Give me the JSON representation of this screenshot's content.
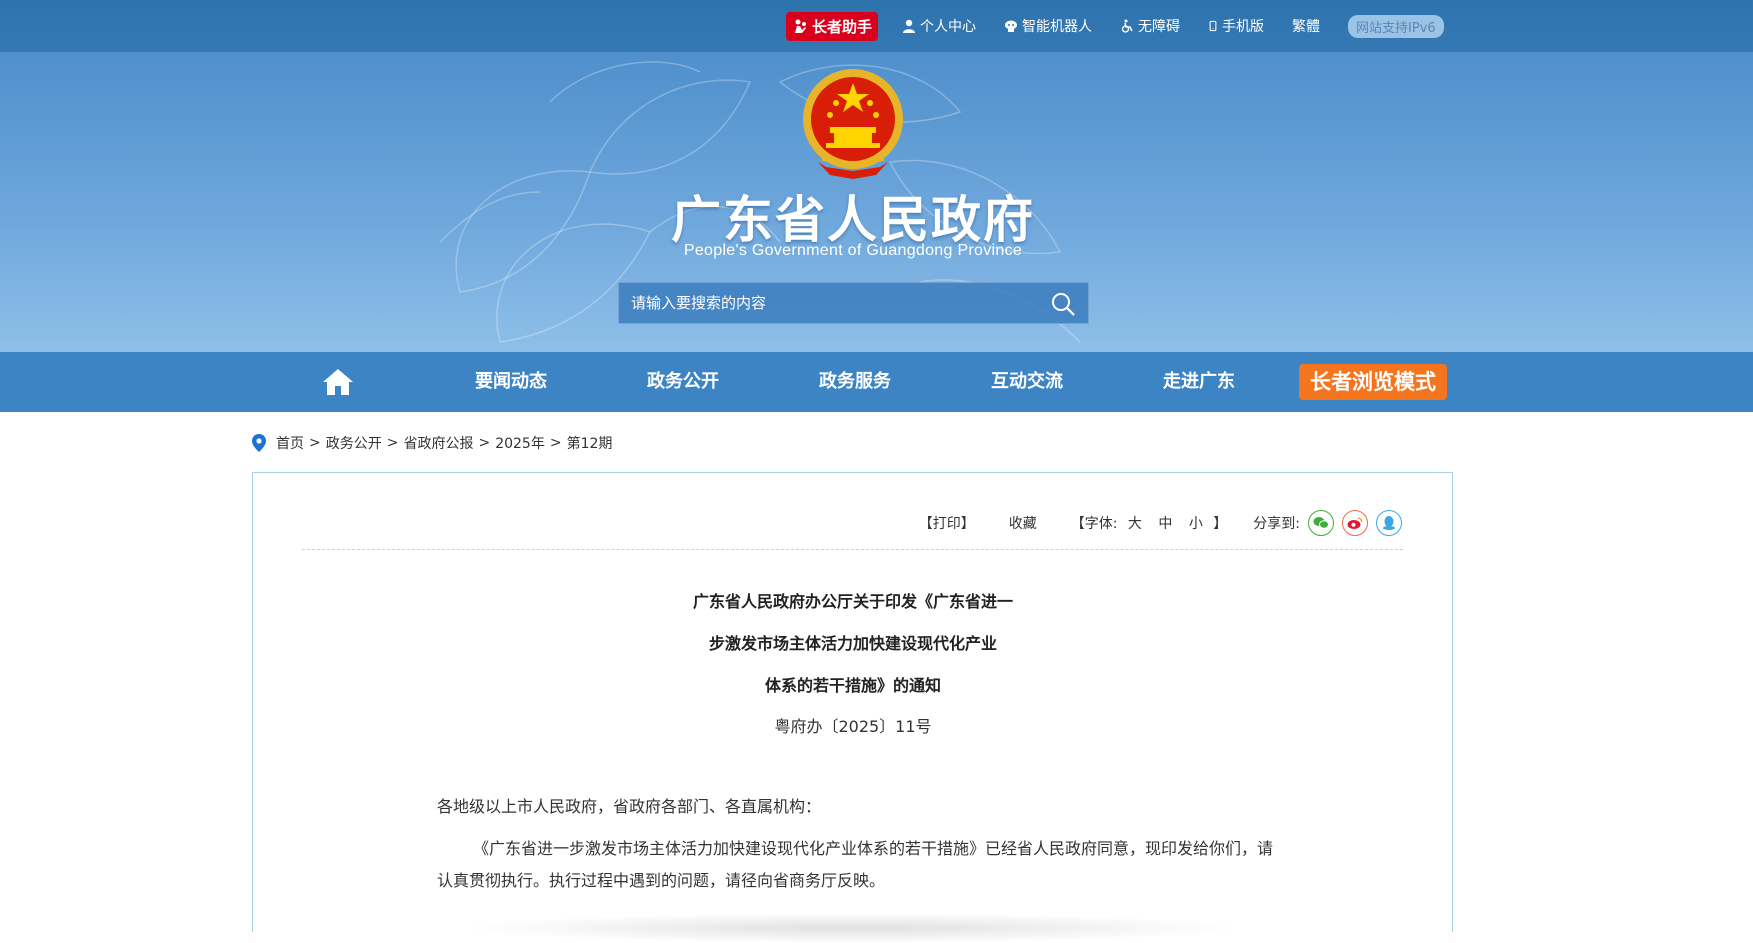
{
  "topbar": {
    "elder_assistant": "长者助手",
    "personal_center": "个人中心",
    "robot": "智能机器人",
    "accessibility": "无障碍",
    "mobile": "手机版",
    "traditional": "繁體",
    "ipv6": "网站支持IPv6"
  },
  "banner": {
    "title": "广东省人民政府",
    "subtitle": "People's Government of Guangdong Province",
    "search_placeholder": "请输入要搜索的内容"
  },
  "nav": {
    "items": [
      "要闻动态",
      "政务公开",
      "政务服务",
      "互动交流",
      "走进广东"
    ],
    "elder_mode": "长者浏览模式"
  },
  "breadcrumb": [
    "首页",
    "政务公开",
    "省政府公报",
    "2025年",
    "第12期"
  ],
  "tools": {
    "print": "【打印】",
    "favorite": "收藏",
    "font_prefix": "【字体:",
    "font_large": "大",
    "font_medium": "中",
    "font_small": "小",
    "font_suffix": "】",
    "share": "分享到:"
  },
  "article": {
    "title_lines": [
      "广东省人民政府办公厅关于印发《广东省进一",
      "步激发市场主体活力加快建设现代化产业",
      "体系的若干措施》的通知"
    ],
    "doc_number": "粤府办〔2025〕11号",
    "salutation": "各地级以上市人民政府，省政府各部门、各直属机构：",
    "body": "《广东省进一步激发市场主体活力加快建设现代化产业体系的若干措施》已经省人民政府同意，现印发给你们，请认真贯彻执行。执行过程中遇到的问题，请径向省商务厅反映。"
  },
  "colors": {
    "topbar": "#3479b4",
    "nav": "#3c84c3",
    "elder_red": "#d8001c",
    "elder_orange": "#f5751f",
    "panel_border": "#a9d1ea"
  }
}
